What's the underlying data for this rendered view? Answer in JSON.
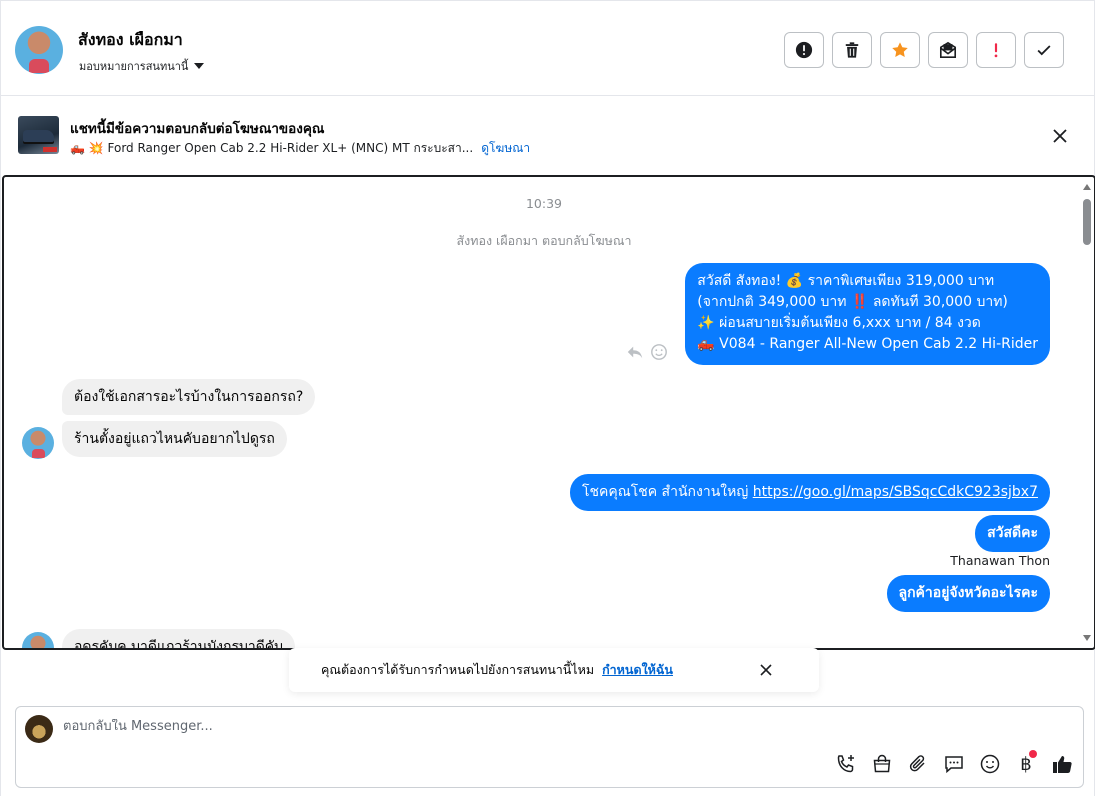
{
  "header": {
    "contact_name": "สังทอง เผือกมา",
    "assign_label": "มอบหมายการสนทนานี้",
    "actions": [
      "warning-icon",
      "trash-icon",
      "star-icon",
      "mark-unread-icon",
      "spam-icon",
      "done-icon"
    ]
  },
  "ad": {
    "title": "แชทนี้มีข้อความตอบกลับต่อโฆษณาของคุณ",
    "subtitle": "🛻 💥 Ford Ranger Open Cab 2.2 Hi-Rider XL+ (MNC) MT กระบะสา...",
    "link": "ดูโฆษณา"
  },
  "chat": {
    "timestamp": "10:39",
    "system_note": "สังทอง เผือกมา ตอบกลับโฆษณา",
    "messages": [
      {
        "direction": "out",
        "lines": [
          "สวัสดี สังทอง! 💰 ราคาพิเศษเพียง 319,000 บาท",
          "(จากปกติ 349,000 บาท ‼️ ลดทันที 30,000 บาท)",
          "✨ ผ่อนสบายเริ่มต้นเพียง 6,xxx บาท / 84 งวด",
          "🛻 V084 - Ranger All-New Open Cab 2.2 Hi-Rider"
        ]
      },
      {
        "direction": "in",
        "text": "ต้องใช้เอกสารอะไรบ้างในการออกรถ?"
      },
      {
        "direction": "in",
        "text": "ร้านตั้งอยู่แถวไหนคับอยากไปดูรถ"
      },
      {
        "direction": "out",
        "text": "โชคคุณโชค สำนักงานใหญ่ ",
        "link": "https://goo.gl/maps/SBSqcCdkC923sjbx7"
      },
      {
        "direction": "out",
        "text": "สวัสดีคะ"
      },
      {
        "direction": "out",
        "text": "ลูกค้าอยู่จังหวัดอะไรคะ",
        "sender": "Thanawan Thon"
      },
      {
        "direction": "in",
        "text": "อดรคับค บาดีแถวร้านบังกรบาดีคับ"
      }
    ]
  },
  "toast": {
    "text": "คุณต้องการได้รับการกำหนดไปยังการสนทนานี้ไหม",
    "link": "กำหนดให้ฉัน"
  },
  "composer": {
    "placeholder": "ตอบกลับใน Messenger...",
    "tools": [
      "call-add-icon",
      "shop-bag-icon",
      "attach-icon",
      "saved-reply-icon",
      "emoji-icon",
      "baht-icon",
      "like-icon"
    ],
    "baht_symbol": "฿"
  },
  "colors": {
    "accent": "#0a7cff",
    "star": "#f7931e",
    "spam": "#f02849",
    "link": "#0064d1"
  }
}
